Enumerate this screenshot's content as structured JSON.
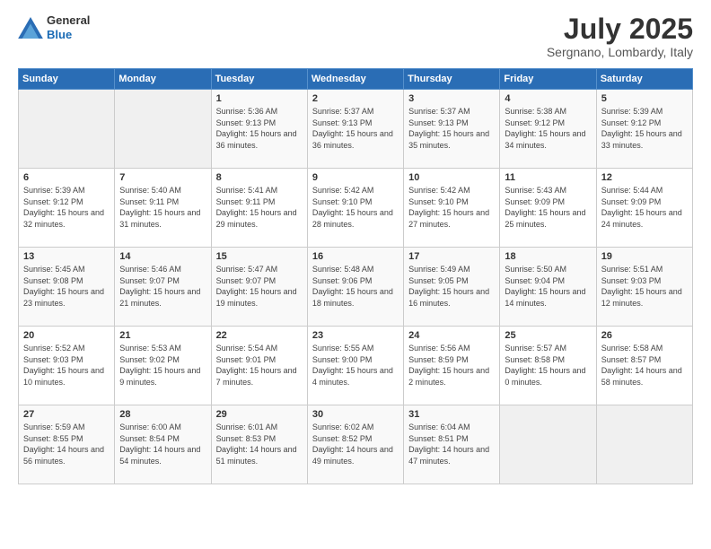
{
  "logo": {
    "line1": "General",
    "line2": "Blue"
  },
  "header": {
    "month": "July 2025",
    "location": "Sergnano, Lombardy, Italy"
  },
  "weekdays": [
    "Sunday",
    "Monday",
    "Tuesday",
    "Wednesday",
    "Thursday",
    "Friday",
    "Saturday"
  ],
  "weeks": [
    [
      {
        "day": "",
        "info": ""
      },
      {
        "day": "",
        "info": ""
      },
      {
        "day": "1",
        "info": "Sunrise: 5:36 AM\nSunset: 9:13 PM\nDaylight: 15 hours\nand 36 minutes."
      },
      {
        "day": "2",
        "info": "Sunrise: 5:37 AM\nSunset: 9:13 PM\nDaylight: 15 hours\nand 36 minutes."
      },
      {
        "day": "3",
        "info": "Sunrise: 5:37 AM\nSunset: 9:13 PM\nDaylight: 15 hours\nand 35 minutes."
      },
      {
        "day": "4",
        "info": "Sunrise: 5:38 AM\nSunset: 9:12 PM\nDaylight: 15 hours\nand 34 minutes."
      },
      {
        "day": "5",
        "info": "Sunrise: 5:39 AM\nSunset: 9:12 PM\nDaylight: 15 hours\nand 33 minutes."
      }
    ],
    [
      {
        "day": "6",
        "info": "Sunrise: 5:39 AM\nSunset: 9:12 PM\nDaylight: 15 hours\nand 32 minutes."
      },
      {
        "day": "7",
        "info": "Sunrise: 5:40 AM\nSunset: 9:11 PM\nDaylight: 15 hours\nand 31 minutes."
      },
      {
        "day": "8",
        "info": "Sunrise: 5:41 AM\nSunset: 9:11 PM\nDaylight: 15 hours\nand 29 minutes."
      },
      {
        "day": "9",
        "info": "Sunrise: 5:42 AM\nSunset: 9:10 PM\nDaylight: 15 hours\nand 28 minutes."
      },
      {
        "day": "10",
        "info": "Sunrise: 5:42 AM\nSunset: 9:10 PM\nDaylight: 15 hours\nand 27 minutes."
      },
      {
        "day": "11",
        "info": "Sunrise: 5:43 AM\nSunset: 9:09 PM\nDaylight: 15 hours\nand 25 minutes."
      },
      {
        "day": "12",
        "info": "Sunrise: 5:44 AM\nSunset: 9:09 PM\nDaylight: 15 hours\nand 24 minutes."
      }
    ],
    [
      {
        "day": "13",
        "info": "Sunrise: 5:45 AM\nSunset: 9:08 PM\nDaylight: 15 hours\nand 23 minutes."
      },
      {
        "day": "14",
        "info": "Sunrise: 5:46 AM\nSunset: 9:07 PM\nDaylight: 15 hours\nand 21 minutes."
      },
      {
        "day": "15",
        "info": "Sunrise: 5:47 AM\nSunset: 9:07 PM\nDaylight: 15 hours\nand 19 minutes."
      },
      {
        "day": "16",
        "info": "Sunrise: 5:48 AM\nSunset: 9:06 PM\nDaylight: 15 hours\nand 18 minutes."
      },
      {
        "day": "17",
        "info": "Sunrise: 5:49 AM\nSunset: 9:05 PM\nDaylight: 15 hours\nand 16 minutes."
      },
      {
        "day": "18",
        "info": "Sunrise: 5:50 AM\nSunset: 9:04 PM\nDaylight: 15 hours\nand 14 minutes."
      },
      {
        "day": "19",
        "info": "Sunrise: 5:51 AM\nSunset: 9:03 PM\nDaylight: 15 hours\nand 12 minutes."
      }
    ],
    [
      {
        "day": "20",
        "info": "Sunrise: 5:52 AM\nSunset: 9:03 PM\nDaylight: 15 hours\nand 10 minutes."
      },
      {
        "day": "21",
        "info": "Sunrise: 5:53 AM\nSunset: 9:02 PM\nDaylight: 15 hours\nand 9 minutes."
      },
      {
        "day": "22",
        "info": "Sunrise: 5:54 AM\nSunset: 9:01 PM\nDaylight: 15 hours\nand 7 minutes."
      },
      {
        "day": "23",
        "info": "Sunrise: 5:55 AM\nSunset: 9:00 PM\nDaylight: 15 hours\nand 4 minutes."
      },
      {
        "day": "24",
        "info": "Sunrise: 5:56 AM\nSunset: 8:59 PM\nDaylight: 15 hours\nand 2 minutes."
      },
      {
        "day": "25",
        "info": "Sunrise: 5:57 AM\nSunset: 8:58 PM\nDaylight: 15 hours\nand 0 minutes."
      },
      {
        "day": "26",
        "info": "Sunrise: 5:58 AM\nSunset: 8:57 PM\nDaylight: 14 hours\nand 58 minutes."
      }
    ],
    [
      {
        "day": "27",
        "info": "Sunrise: 5:59 AM\nSunset: 8:55 PM\nDaylight: 14 hours\nand 56 minutes."
      },
      {
        "day": "28",
        "info": "Sunrise: 6:00 AM\nSunset: 8:54 PM\nDaylight: 14 hours\nand 54 minutes."
      },
      {
        "day": "29",
        "info": "Sunrise: 6:01 AM\nSunset: 8:53 PM\nDaylight: 14 hours\nand 51 minutes."
      },
      {
        "day": "30",
        "info": "Sunrise: 6:02 AM\nSunset: 8:52 PM\nDaylight: 14 hours\nand 49 minutes."
      },
      {
        "day": "31",
        "info": "Sunrise: 6:04 AM\nSunset: 8:51 PM\nDaylight: 14 hours\nand 47 minutes."
      },
      {
        "day": "",
        "info": ""
      },
      {
        "day": "",
        "info": ""
      }
    ]
  ]
}
